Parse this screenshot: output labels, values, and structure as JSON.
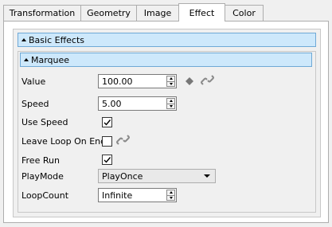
{
  "tabs": [
    {
      "label": "Transformation",
      "active": false
    },
    {
      "label": "Geometry",
      "active": false
    },
    {
      "label": "Image",
      "active": false
    },
    {
      "label": "Effect",
      "active": true
    },
    {
      "label": "Color",
      "active": false
    }
  ],
  "groups": {
    "basic_effects": {
      "title": "Basic Effects"
    },
    "marquee": {
      "title": "Marquee"
    }
  },
  "fields": {
    "value": {
      "label": "Value",
      "value": "100.00"
    },
    "speed": {
      "label": "Speed",
      "value": "5.00"
    },
    "use_speed": {
      "label": "Use Speed",
      "checked": true
    },
    "leave_loop_on_end": {
      "label": "Leave Loop On End",
      "checked": false
    },
    "free_run": {
      "label": "Free Run",
      "checked": true
    },
    "play_mode": {
      "label": "PlayMode",
      "value": "PlayOnce"
    },
    "loop_count": {
      "label": "LoopCount",
      "value": "Infinite"
    }
  },
  "icons": {
    "keyframe": "diamond-icon",
    "link": "link-icon"
  },
  "colors": {
    "header_bg": "#cde8fb",
    "header_border": "#6fa9d6"
  }
}
